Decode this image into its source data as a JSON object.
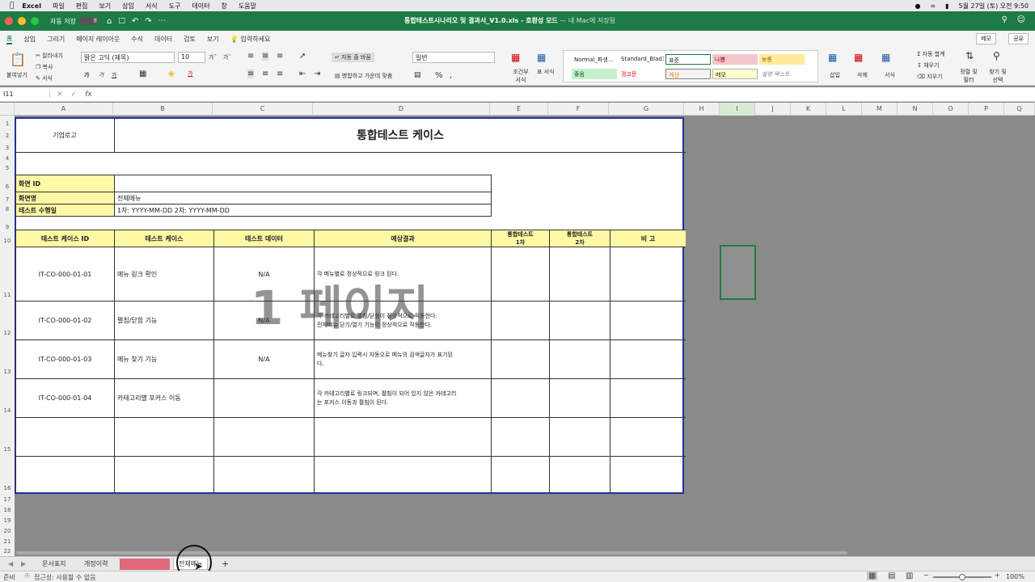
{
  "mac_menu": {
    "app": "Excel",
    "items": [
      "파일",
      "편집",
      "보기",
      "삽입",
      "서식",
      "도구",
      "데이터",
      "창",
      "도움말"
    ],
    "datetime": "5월 27일 (토) 오전 9:50"
  },
  "window": {
    "autosave_label": "자동 저장",
    "autosave_state": "끔",
    "title": "통합테스트시나리오 및 결과서_V1.0.xls - 호환성 모드",
    "saved_status": "— 내 Mac에 저장됨"
  },
  "ribbon_tabs": [
    "홈",
    "삽입",
    "그리기",
    "페이지 레이아웃",
    "수식",
    "데이터",
    "검토",
    "보기"
  ],
  "tell_me": "입력하세요",
  "memo_button": "메모",
  "share_button": "공유",
  "ribbon": {
    "paste": "붙여넣기",
    "cut": "잘라내기",
    "copy": "복사",
    "format_painter": "서식",
    "font_name": "맑은 고딕 (제목)",
    "font_size": "10",
    "wrap_text": "자동 줄 바꿈",
    "merge_center": "병합하고 가운데 맞춤",
    "number_format": "일반",
    "cond_format": "조건부 서식",
    "table_format": "표 서식",
    "styles": [
      {
        "name": "Normal_파생...",
        "bg": "#ffffff",
        "fg": "#222222"
      },
      {
        "name": "Standard_Blad1",
        "bg": "#ffffff",
        "fg": "#222222"
      },
      {
        "name": "표준",
        "bg": "#ffffff",
        "fg": "#222222"
      },
      {
        "name": "나쁨",
        "bg": "#f4c7ce",
        "fg": "#9c0006"
      },
      {
        "name": "보통",
        "bg": "#ffeb9c",
        "fg": "#9c5700"
      },
      {
        "name": "좋음",
        "bg": "#c6efce",
        "fg": "#006100"
      },
      {
        "name": "경고문",
        "bg": "#ffffff",
        "fg": "#ff0000"
      },
      {
        "name": "계산",
        "bg": "#f2f2f2",
        "fg": "#fa7d00"
      },
      {
        "name": "메모",
        "bg": "#ffffcc",
        "fg": "#222222"
      },
      {
        "name": "설명 텍스트",
        "bg": "#ffffff",
        "fg": "#7f7f7f"
      }
    ],
    "insert": "삽입",
    "delete": "삭제",
    "format": "서식",
    "autosum": "자동 합계",
    "fill": "채우기",
    "clear": "지우기",
    "sort_filter": "정렬 및 필터",
    "find_select": "찾기 및 선택"
  },
  "formula_bar": {
    "cell_ref": "I11",
    "fx": "fx",
    "value": ""
  },
  "columns": [
    "A",
    "B",
    "C",
    "D",
    "E",
    "F",
    "G",
    "H",
    "I",
    "J",
    "K",
    "L",
    "M",
    "N",
    "O",
    "P",
    "Q"
  ],
  "rows": [
    "1",
    "2",
    "3",
    "4",
    "5",
    "6",
    "7",
    "8",
    "9",
    "10",
    "11",
    "12",
    "13",
    "14",
    "15",
    "16",
    "17",
    "18",
    "19",
    "20",
    "21",
    "22"
  ],
  "sheet": {
    "logo": "기업로고",
    "title": "통합테스트 케이스",
    "info": [
      {
        "label": "화면 ID",
        "value": ""
      },
      {
        "label": "화면명",
        "value": "전체메뉴"
      },
      {
        "label": "테스트 수행일",
        "value": "1차: YYYY-MM-DD  2차: YYYY-MM-DD"
      }
    ],
    "headers": [
      "테스트 케이스 ID",
      "테스트 케이스",
      "테스트 데이터",
      "예상결과",
      "통합테스트\n1차",
      "통합테스트\n2차",
      "비 고"
    ],
    "cases": [
      {
        "id": "IT-CO-000-01-01",
        "case": "메뉴 링크 확인",
        "data": "N/A",
        "expected": "각 메뉴별로 정상적으로 링크 된다.",
        "r1": "",
        "r2": "",
        "note": ""
      },
      {
        "id": "IT-CO-000-01-02",
        "case": "펼침/닫힘 기능",
        "data": "N/A",
        "expected": "각 카테고리별로 펼침/닫힘이 정상적으로 작동한다.\n전체메뉴 닫기/열기 기능이 정상적으로 작동한다.",
        "r1": "",
        "r2": "",
        "note": ""
      },
      {
        "id": "IT-CO-000-01-03",
        "case": "메뉴 찾기 기능",
        "data": "N/A",
        "expected": "메뉴찾기 글자 입력시 자동으로 메뉴의 검색글자가 표기된\n다.",
        "r1": "",
        "r2": "",
        "note": ""
      },
      {
        "id": "IT-CO-000-01-04",
        "case": "카테고리별 포커스 이동",
        "data": "",
        "expected": "각 카테고리별로 링크되며, 펼침이 되어 있지 않은 카테고리\n는 포커스 이동과 펼침이 된다.",
        "r1": "",
        "r2": "",
        "note": ""
      },
      {
        "id": "",
        "case": "",
        "data": "",
        "expected": "",
        "r1": "",
        "r2": "",
        "note": ""
      },
      {
        "id": "",
        "case": "",
        "data": "",
        "expected": "",
        "r1": "",
        "r2": "",
        "note": ""
      }
    ],
    "watermark": "1 페이지"
  },
  "sheet_tabs": [
    {
      "label": "문서표지",
      "active": false
    },
    {
      "label": "개정이력",
      "active": false
    },
    {
      "label": "",
      "active": false,
      "color": "#e06a7a"
    },
    {
      "label": "전체메뉴",
      "active": true
    }
  ],
  "status": {
    "ready": "준비",
    "accessibility": "접근성: 사용할 수 없음",
    "zoom": "100%"
  }
}
